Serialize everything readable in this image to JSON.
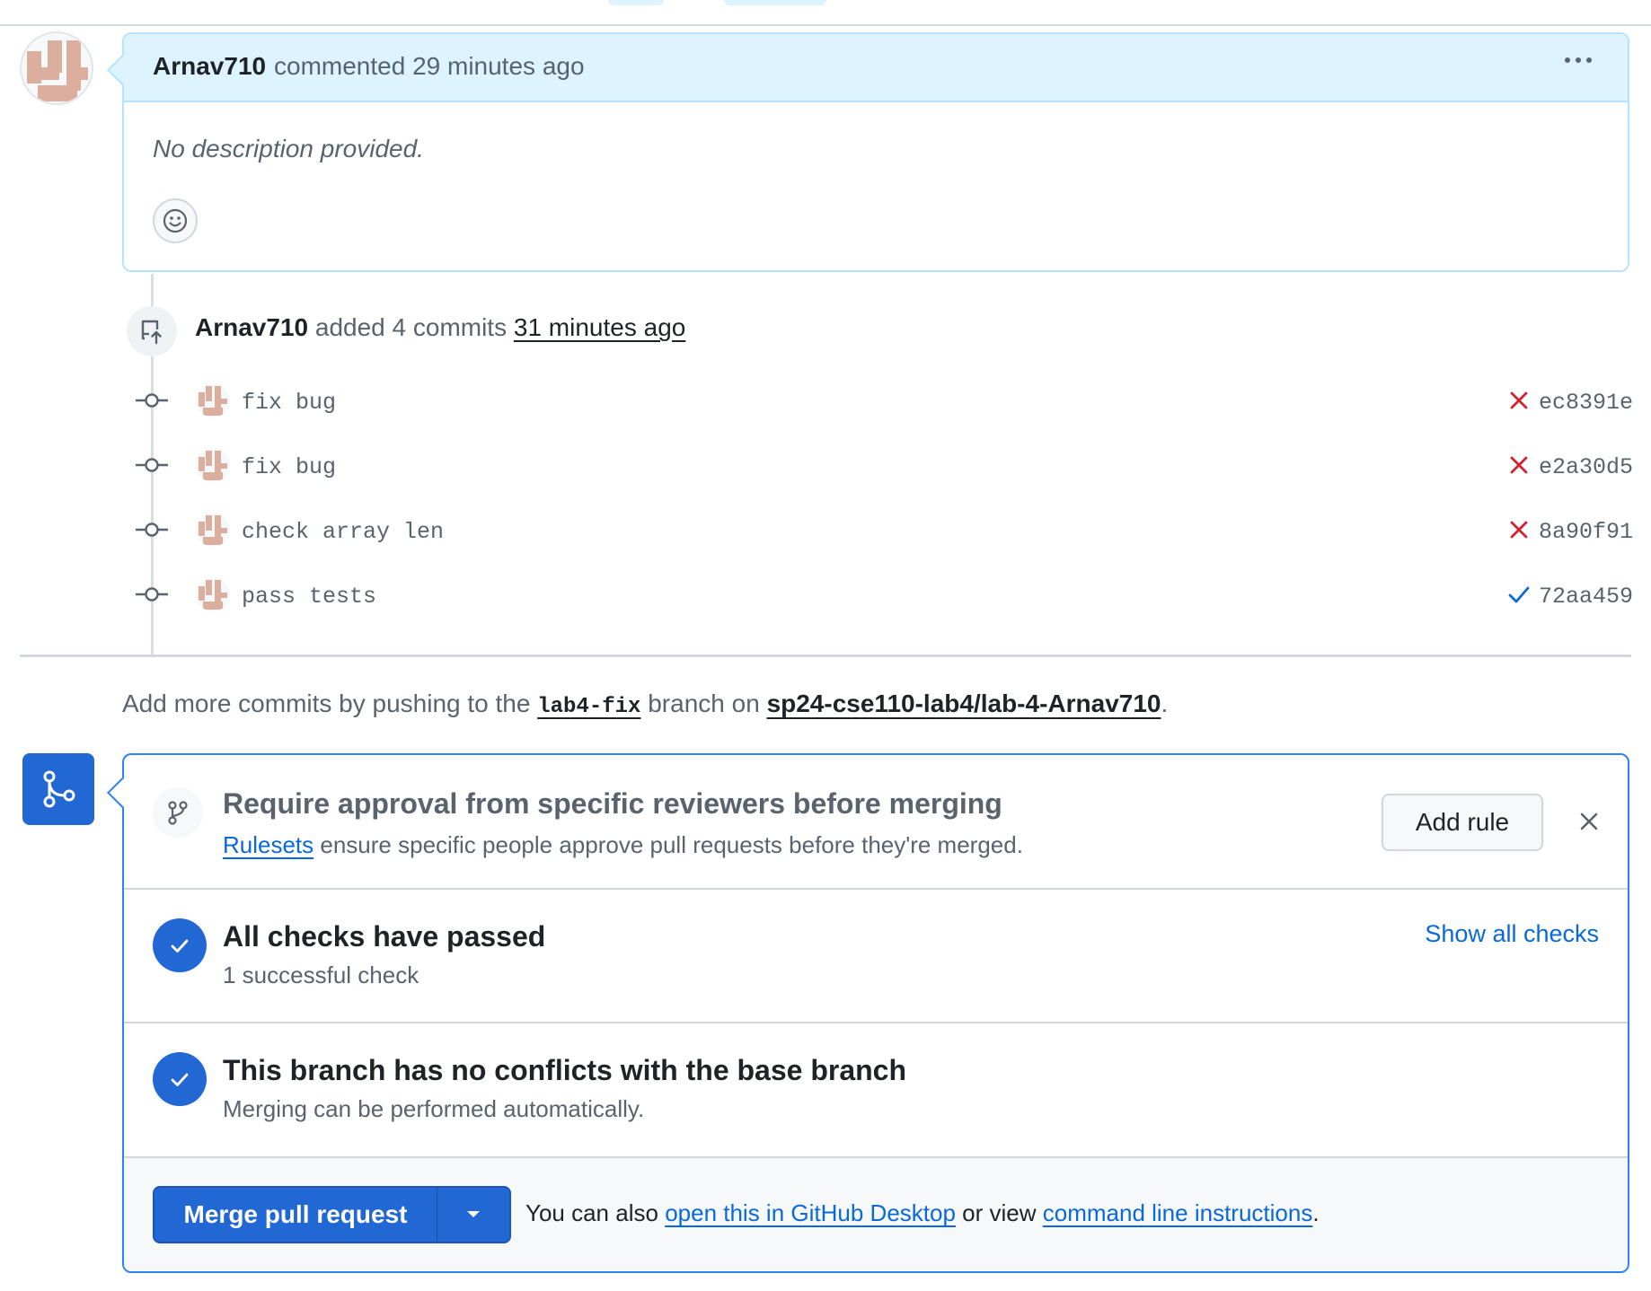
{
  "comment": {
    "author": "Arnav710",
    "meta": "commented 29 minutes ago",
    "body": "No description provided."
  },
  "commits_header": {
    "author": "Arnav710",
    "action": "added 4 commits",
    "time": "31 minutes ago"
  },
  "commits": [
    {
      "message": "fix bug",
      "sha": "ec8391e",
      "status": "failure"
    },
    {
      "message": "fix bug",
      "sha": "e2a30d5",
      "status": "failure"
    },
    {
      "message": "check array len",
      "sha": "8a90f91",
      "status": "failure"
    },
    {
      "message": "pass tests",
      "sha": "72aa459",
      "status": "success"
    }
  ],
  "info": {
    "prefix": "Add more commits by pushing to the",
    "branch": "lab4-fix",
    "middle": "branch on",
    "repo": "sp24-cse110-lab4/lab-4-Arnav710",
    "suffix": "."
  },
  "merge_box": {
    "rule": {
      "title": "Require approval from specific reviewers before merging",
      "link": "Rulesets",
      "subtitle": "ensure specific people approve pull requests before they're merged.",
      "add_rule_label": "Add rule"
    },
    "checks": {
      "title": "All checks have passed",
      "subtitle": "1 successful check",
      "show_all": "Show all checks"
    },
    "conflicts": {
      "title": "This branch has no conflicts with the base branch",
      "subtitle": "Merging can be performed automatically."
    },
    "footer": {
      "merge_label": "Merge pull request",
      "text_1": "You can also",
      "link_1": "open this in GitHub Desktop",
      "text_2": "or view",
      "link_2": "command line instructions",
      "text_3": "."
    }
  },
  "colors": {
    "accent": "#2168d5",
    "failure": "#cf222e",
    "success": "#0969da",
    "comment_header": "#ddf4ff"
  }
}
